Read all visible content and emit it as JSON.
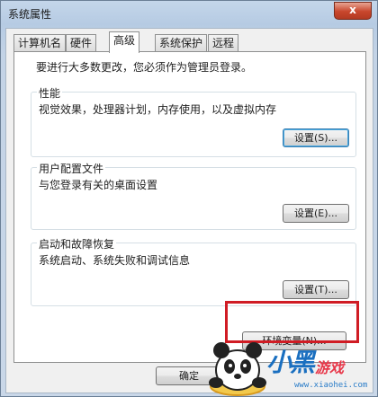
{
  "window": {
    "title": "系统属性",
    "close_label": "x"
  },
  "tabs": [
    {
      "label": "计算机名"
    },
    {
      "label": "硬件"
    },
    {
      "label": "高级",
      "active": true
    },
    {
      "label": "系统保护"
    },
    {
      "label": "远程"
    }
  ],
  "admin_notice": "要进行大多数更改，您必须作为管理员登录。",
  "groups": {
    "performance": {
      "title": "性能",
      "description": "视觉效果，处理器计划，内存使用，以及虚拟内存",
      "button": "设置(S)..."
    },
    "user_profiles": {
      "title": "用户配置文件",
      "description": "与您登录有关的桌面设置",
      "button": "设置(E)..."
    },
    "startup_recovery": {
      "title": "启动和故障恢复",
      "description": "系统启动、系统失败和调试信息",
      "button": "设置(T)..."
    }
  },
  "env_button": "环境变量(N)...",
  "footer": {
    "ok_button": "确定"
  },
  "watermark": {
    "brand": "小黑",
    "brand_suffix": "游戏",
    "url": "www.xiaohei.com",
    "highlight_color": "#d01c24"
  },
  "icons": {
    "close": "close-icon",
    "mascot": "panda-mascot-icon"
  }
}
